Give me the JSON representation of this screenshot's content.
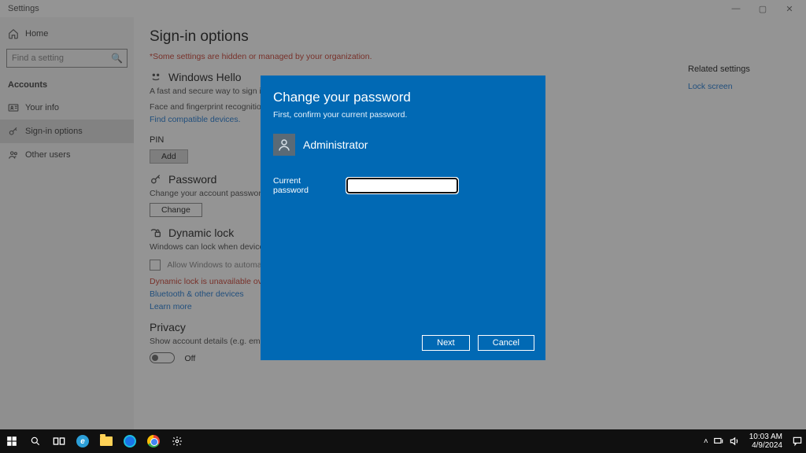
{
  "window": {
    "title": "Settings"
  },
  "sidebar": {
    "home": "Home",
    "search_placeholder": "Find a setting",
    "heading": "Accounts",
    "items": [
      {
        "label": "Your info"
      },
      {
        "label": "Sign-in options"
      },
      {
        "label": "Other users"
      }
    ]
  },
  "content": {
    "title": "Sign-in options",
    "org_warning": "*Some settings are hidden or managed by your organization.",
    "hello": {
      "heading": "Windows Hello",
      "desc1": "A fast and secure way to sign in to Windows, make payments, and connect to apps and services.",
      "desc2": "Face and fingerprint recognition are not available on this device.",
      "link": "Find compatible devices."
    },
    "pin": {
      "heading": "PIN",
      "button": "Add"
    },
    "password": {
      "heading": "Password",
      "desc": "Change your account password",
      "button": "Change"
    },
    "dynamic": {
      "heading": "Dynamic lock",
      "desc": "Windows can lock when devices paired to your PC go out of range.",
      "checkbox_label": "Allow Windows to automatically lock your device when you're away",
      "warning": "Dynamic lock is unavailable over remote sessions.",
      "link1": "Bluetooth & other devices",
      "link2": "Learn more"
    },
    "privacy": {
      "heading": "Privacy",
      "desc": "Show account details (e.g. email address) on sign-in screen",
      "toggle": "Off"
    }
  },
  "related": {
    "heading": "Related settings",
    "link": "Lock screen"
  },
  "dialog": {
    "title": "Change your password",
    "subtitle": "First, confirm your current password.",
    "user": "Administrator",
    "field_label": "Current password",
    "value": "",
    "next": "Next",
    "cancel": "Cancel"
  },
  "taskbar": {
    "time": "10:03 AM",
    "date": "4/9/2024"
  }
}
